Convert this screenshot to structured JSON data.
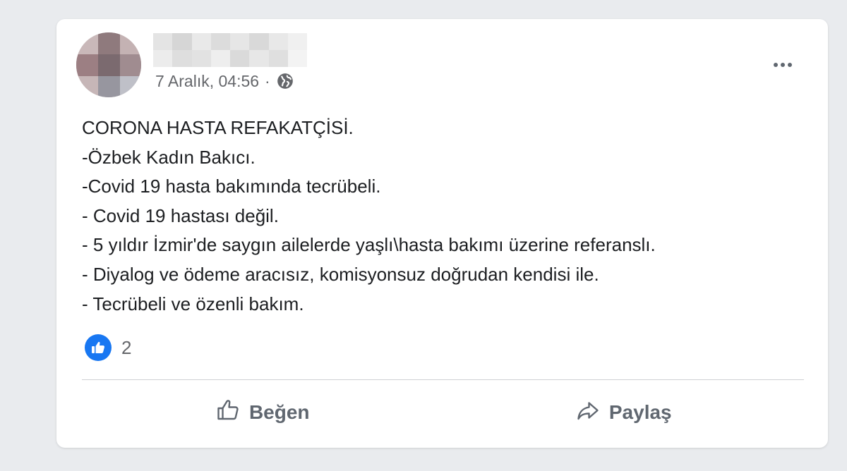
{
  "post": {
    "author_name": "",
    "date": "7 Aralık, 04:56",
    "separator": "·",
    "lines": [
      "CORONA HASTA REFAKATÇİSİ.",
      "-Özbek Kadın Bakıcı.",
      "-Covid 19 hasta bakımında tecrübeli.",
      "- Covid 19 hastası değil.",
      "- 5 yıldır İzmir'de saygın ailelerde yaşlı\\hasta bakımı üzerine referanslı.",
      "- Diyalog ve ödeme aracısız, komisyonsuz doğrudan kendisi ile.",
      "- Tecrübeli ve özenli bakım."
    ],
    "reaction_count": "2"
  },
  "actions": {
    "like_label": "Beğen",
    "share_label": "Paylaş"
  },
  "icons": {
    "privacy": "globe-icon",
    "menu": "more-options-icon",
    "reaction": "like-reaction-icon",
    "like": "thumbs-up-icon",
    "share": "share-arrow-icon"
  },
  "colors": {
    "background": "#e9ebee",
    "card": "#ffffff",
    "text": "#1c1e21",
    "secondary_text": "#65676b",
    "like_blue": "#1877f2"
  }
}
